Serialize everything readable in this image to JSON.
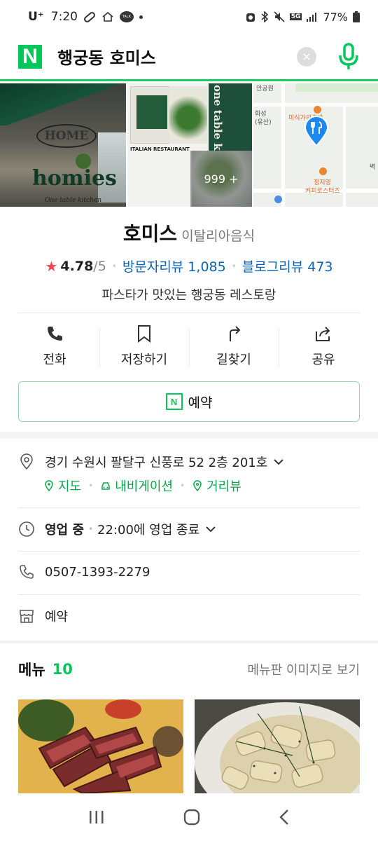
{
  "status_bar": {
    "carrier": "U⁺",
    "time": "7:20",
    "talk_badge": "TALK",
    "network": "5G",
    "battery": "77%"
  },
  "search": {
    "logo": "N",
    "query": "행궁동 호미스",
    "clear": "×"
  },
  "gallery": {
    "photo1_sign": "HOME",
    "photo1_script": "homies",
    "photo1_tagline": "One table kitchen",
    "photo2_vertical": "one table kitchen",
    "photo2_caption": "ITALIAN RESTAURANT",
    "more_count": "999 +",
    "map_labels": [
      "안공원",
      "미식가의주방",
      "화성",
      "(유산)",
      "정지영",
      "커피로스터즈",
      "벽"
    ]
  },
  "place": {
    "name": "호미스",
    "category": "이탈리아음식",
    "rating": "4.78",
    "rating_max": "/5",
    "visitor_reviews": "방문자리뷰 1,085",
    "blog_reviews": "블로그리뷰 473",
    "description": "파스타가 맛있는 행궁동 레스토랑"
  },
  "actions": [
    {
      "label": "전화",
      "icon": "phone-icon"
    },
    {
      "label": "저장하기",
      "icon": "bookmark-icon"
    },
    {
      "label": "길찾기",
      "icon": "directions-icon"
    },
    {
      "label": "공유",
      "icon": "share-icon"
    }
  ],
  "reserve_button": {
    "badge": "N",
    "label": "예약"
  },
  "info": {
    "address": "경기 수원시 팔달구 신풍로 52 2층 201호",
    "map_link": "지도",
    "navi_link": "내비게이션",
    "street_link": "거리뷰",
    "hours_status": "영업 중",
    "hours_detail": "22:00에 영업 종료",
    "phone": "0507-1393-2279",
    "booking": "예약"
  },
  "menu": {
    "title": "메뉴",
    "count": "10",
    "view_link": "메뉴판 이미지로 보기"
  },
  "colors": {
    "brand_green": "#03c75a",
    "link_blue": "#0b63b5",
    "star_red": "#f2474d"
  }
}
